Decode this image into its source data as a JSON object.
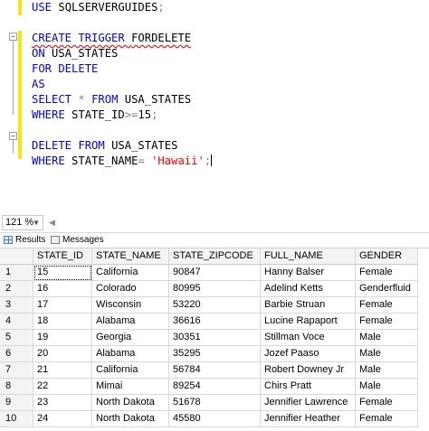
{
  "editor": {
    "lines": [
      [
        {
          "t": "USE ",
          "c": "kw"
        },
        {
          "t": "SQLSERVERGUIDES",
          "c": "id"
        },
        {
          "t": ";",
          "c": "op"
        }
      ],
      [],
      [
        {
          "t": "CREATE TRIGGER ",
          "c": "kw",
          "sq": true
        },
        {
          "t": "FORDELETE",
          "c": "id",
          "sq": true
        }
      ],
      [
        {
          "t": "ON ",
          "c": "kw"
        },
        {
          "t": "USA_STATES",
          "c": "id"
        }
      ],
      [
        {
          "t": "FOR DELETE",
          "c": "kw"
        }
      ],
      [
        {
          "t": "AS",
          "c": "kw"
        }
      ],
      [
        {
          "t": "SELECT ",
          "c": "kw"
        },
        {
          "t": "* ",
          "c": "op"
        },
        {
          "t": "FROM ",
          "c": "kw"
        },
        {
          "t": "USA_STATES",
          "c": "id"
        }
      ],
      [
        {
          "t": "WHERE ",
          "c": "kw"
        },
        {
          "t": "STATE_ID",
          "c": "id"
        },
        {
          "t": ">=",
          "c": "op"
        },
        {
          "t": "15",
          "c": "id"
        },
        {
          "t": ";",
          "c": "op"
        }
      ],
      [],
      [
        {
          "t": "DELETE FROM ",
          "c": "kw"
        },
        {
          "t": "USA_STATES",
          "c": "id"
        }
      ],
      [
        {
          "t": "WHERE ",
          "c": "kw"
        },
        {
          "t": "STATE_NAME",
          "c": "id"
        },
        {
          "t": "= ",
          "c": "op"
        },
        {
          "t": "'Hawaii'",
          "c": "str"
        },
        {
          "t": ";",
          "c": "op"
        }
      ]
    ]
  },
  "zoom": {
    "value": "121 %"
  },
  "tabs": {
    "results": "Results",
    "messages": "Messages"
  },
  "grid": {
    "columns": [
      "STATE_ID",
      "STATE_NAME",
      "STATE_ZIPCODE",
      "FULL_NAME",
      "GENDER"
    ],
    "rows": [
      [
        "1",
        "15",
        "California",
        "90847",
        "Hanny Balser",
        "Female"
      ],
      [
        "2",
        "16",
        "Colorado",
        "80995",
        "Adelind Ketts",
        "Genderfluid"
      ],
      [
        "3",
        "17",
        "Wisconsin",
        "53220",
        "Barbie Struan",
        "Female"
      ],
      [
        "4",
        "18",
        "Alabama",
        "36616",
        "Lucine Rapaport",
        "Female"
      ],
      [
        "5",
        "19",
        "Georgia",
        "30351",
        "Stillman Voce",
        "Male"
      ],
      [
        "6",
        "20",
        "Alabama",
        "35295",
        "Jozef Paaso",
        "Male"
      ],
      [
        "7",
        "21",
        "California",
        "56784",
        "Robert Downey Jr",
        "Male"
      ],
      [
        "8",
        "22",
        "Mimai",
        "89254",
        "Chirs Pratt",
        "Male"
      ],
      [
        "9",
        "23",
        "North Dakota",
        "51678",
        "Jennifier Lawrence",
        "Female"
      ],
      [
        "10",
        "24",
        "North Dakota",
        "45580",
        "Jennifier Heather",
        "Female"
      ]
    ]
  }
}
